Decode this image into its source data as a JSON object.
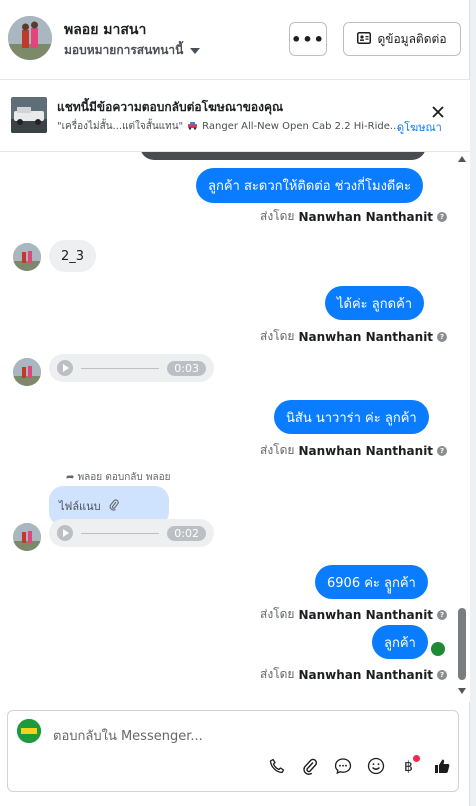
{
  "header": {
    "name": "พลอย มาสนา",
    "assignee": "มอบหมายการสนทนานี้",
    "more_label": "•••",
    "contact_label": "ดูข้อมูลติดต่อ"
  },
  "banner": {
    "title": "แชทนี้มีข้อความตอบกลับต่อโฆษณาของคุณ",
    "ad_caption": "\"เครื่องไม่สั้น...แต่ใจสั้นแทน\"",
    "ad_model": "Ranger All-New Open Cab 2.2 Hi-Ride...",
    "view_ad": "ดูโฆษณา"
  },
  "messages": {
    "m1_text": "ลูกค้า สะดวกให้ติดต่อ ช่วงกี่โมงดีคะ",
    "sent_prefix": "ส่งโดย",
    "sender": "Nanwhan Nanthanit",
    "m2_text": "2_3",
    "m3_text": "ได้ค่ะ  ลูกดค้า",
    "audio1_duration": "0:03",
    "m4_text": "นิสัน นาวาร่า ค่ะ  ลูกค้า",
    "reply_note": "พลอย ตอบกลับ พลอย",
    "attachment_label": "ไฟล์แนบ",
    "audio2_duration": "0:02",
    "m5_text": "6906 ค่ะ  ลููกค้า",
    "m6_text": "ลูกค้า"
  },
  "composer": {
    "placeholder": "ตอบกลับใน Messenger..."
  },
  "colors": {
    "outgoing_bubble": "#0a7cff",
    "incoming_bubble": "#eeeff1",
    "link": "#1877f2"
  },
  "icons": {
    "more": "more-icon",
    "contact": "contact-card-icon",
    "close": "close-icon",
    "phone": "phone-icon",
    "attach": "paperclip-icon",
    "saved_reply": "chat-bubble-icon",
    "emoji": "emoji-icon",
    "payment": "baht-icon",
    "like": "thumbs-up-icon"
  }
}
